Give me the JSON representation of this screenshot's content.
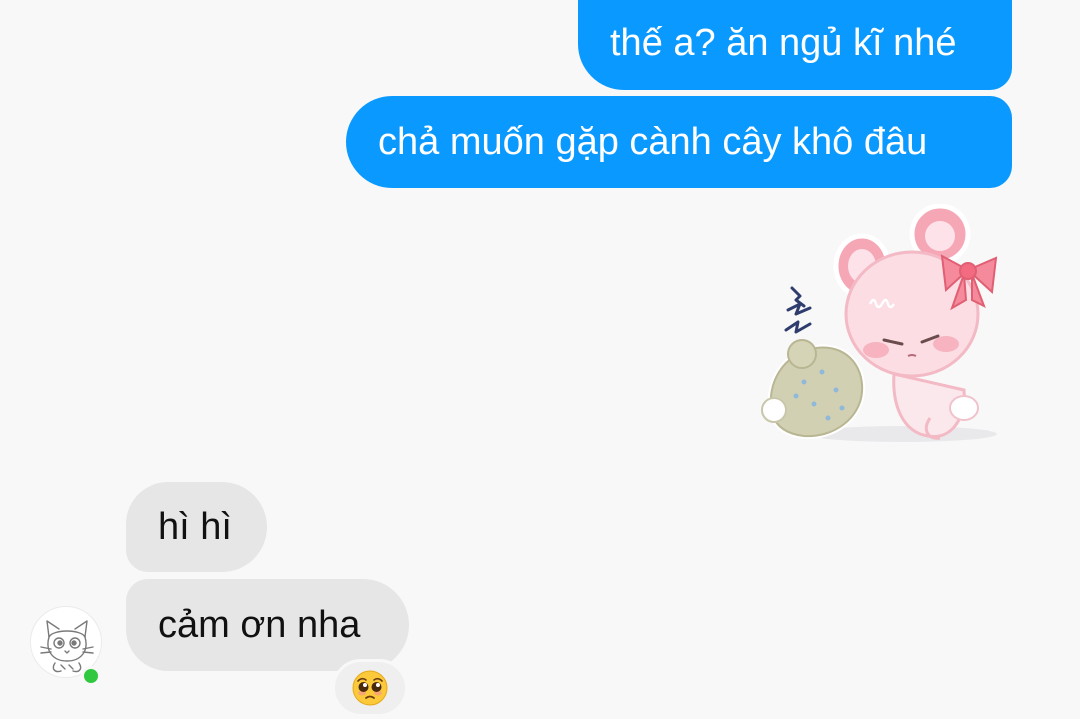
{
  "colors": {
    "outgoing_bubble": "#0a99ff",
    "incoming_bubble": "#e6e6e6",
    "online_indicator": "#30c83f"
  },
  "messages": {
    "outgoing": [
      {
        "text": "thế a? ăn ngủ kĩ nhé"
      },
      {
        "text": "chả muốn gặp cành cây khô đâu"
      }
    ],
    "sticker": {
      "icon": "pink-bunny-sticker"
    },
    "incoming": [
      {
        "text": "hì hì"
      },
      {
        "text": "cảm ơn nha"
      }
    ],
    "reaction": {
      "icon": "pleading-face-emoji"
    }
  },
  "contact": {
    "avatar_icon": "cat-avatar",
    "online": true
  }
}
